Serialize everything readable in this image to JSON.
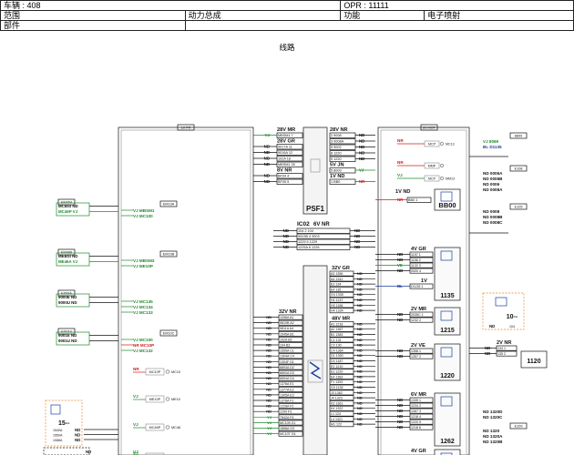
{
  "header": {
    "vehicle_label": "车辆 : 408",
    "opr_label": "OPR : 11111",
    "scope_label": "范围",
    "scope_value": "动力总成",
    "function_label": "功能",
    "function_value": "电子喷射",
    "part_label": "部件"
  },
  "diagram_title": "线路",
  "colors": {
    "blue": "#1a3fa0",
    "green": "#1f8a2c",
    "red": "#d01b1b",
    "orange": "#e8892a",
    "grey": "#9a9a9a",
    "line": "#111111"
  },
  "frames": {
    "left_tag": "10 PR",
    "right_tag": "20 MOT"
  },
  "psf1": {
    "label": "PSF1",
    "left_rows": [
      {
        "title": "28V MR",
        "sig": "VJ",
        "text": "MBSM1 7"
      },
      {
        "title": "28V GR",
        "sig": "ND",
        "text": "9017A 11"
      },
      {
        "sig": "ND",
        "text": "9016A 12"
      },
      {
        "sig": "ND",
        "text": "102A 16"
      },
      {
        "sig": "ND",
        "text": "MBSM1 26"
      },
      {
        "title": "8V NR",
        "sig": "ND",
        "text": "BF04 4"
      },
      {
        "sig": "ND",
        "text": "BF05 5"
      }
    ],
    "right_rows": [
      {
        "title": "28V NR",
        "sig": "ND",
        "text": "2 9008"
      },
      {
        "sig": "ND",
        "text": "3 9008A"
      },
      {
        "sig": "ND",
        "text": "5 9002"
      },
      {
        "sig": "ND",
        "text": "8 1220"
      },
      {
        "sig": "ND",
        "text": "9 1220"
      },
      {
        "title": "5V JN",
        "sig": "VJ",
        "text": "5 8009"
      },
      {
        "title": "1V ND",
        "sig": "NR",
        "text": "1 BB0"
      }
    ]
  },
  "ic02": {
    "label": "IC02",
    "label2": "6V NR",
    "rows": [
      {
        "l": "ND",
        "text": "104 2 104",
        "r": "ND"
      },
      {
        "l": "ND",
        "text": "9003B 4 9003",
        "r": "ND"
      },
      {
        "l": "ND",
        "text": "1229 5 1229",
        "r": "ND"
      },
      {
        "l": "ND",
        "text": "1225A 6 1226",
        "r": "ND"
      }
    ]
  },
  "fuse_block": {
    "groups": [
      {
        "title": "32V GR",
        "rows": [
          "A3 1356",
          "A4 1341",
          "E3 134",
          "E4 135",
          "G4 1335",
          "H1 1137",
          "H3 1156",
          "H4 1334"
        ]
      },
      {
        "title": "48V MR",
        "rows": [
          "A1 1218",
          "A2 1387",
          "B1 1383",
          "C1 131",
          "C2 130",
          "C4 1364",
          "D1 1300",
          "D3 1187",
          "E2 1210",
          "E3 1220",
          "E4 1383",
          "F1 1393",
          "G3 1135",
          "J3 1362",
          "J4 1323",
          "K3 1361",
          "K4 1322",
          "L1 124",
          "L4 1321",
          "M1 122"
        ]
      }
    ],
    "left_title": "32V NR",
    "left_rows": [
      "1056A A1",
      "9810B A2",
      "9811A A4",
      "1545A B1",
      "102A B2",
      "104 B3",
      "1555A C1",
      "1304A C4",
      "1304F D1",
      "6893A D2",
      "6892A D3",
      "6894A D4",
      "1378A E1",
      "1377A E2",
      "1305A E3",
      "1378A F1",
      "1228A F2",
      "1299 F3",
      "7842A F4",
      "MC105 G1",
      "1858A G3",
      "MC10T G4"
    ],
    "left_sig": [
      "ND",
      "ND",
      "ND",
      "ND",
      "ND",
      "ND",
      "ND",
      "ND",
      "ND",
      "ND",
      "ND",
      "ND",
      "ND",
      "ND",
      "ND",
      "ND",
      "ND",
      "ND",
      "VJ",
      "VJ",
      "VJ",
      "VJ"
    ]
  },
  "bb00": {
    "label": "BB00",
    "row_title": "1V ND",
    "row_text": "BB0 1",
    "sig": "NR"
  },
  "left_components": [
    {
      "code": "EM454",
      "sigs": [
        "MCBSI ND",
        "MC46P VJ"
      ],
      "conn": "EM10A",
      "wires": [
        "VJ MBSM1",
        "VJ MC100"
      ]
    },
    {
      "code": "EM488",
      "sigs": [
        "MEBSI ND",
        "ME46A VJ"
      ],
      "conn": "EM10B",
      "wires": [
        "VJ MBSM3",
        "VJ ME10P"
      ]
    },
    {
      "code": "EX09A",
      "sigs": [
        "9000E ND",
        "9000U ND"
      ],
      "wires": [
        "VJ MC135",
        "VJ MC134",
        "VJ MC133"
      ]
    },
    {
      "code": "EX014",
      "sigs": [
        "9001E ND",
        "9001U ND"
      ],
      "conn": "EM10C",
      "wires": [
        "VJ MC100",
        "NR MC10P",
        "VJ MC132"
      ]
    }
  ],
  "bus_items": [
    {
      "sig": "NR",
      "label": "MC10P",
      "tag": "MC10"
    },
    {
      "sig": "VJ",
      "label": "ME10P",
      "tag": "ME10"
    },
    {
      "sig": "VJ",
      "label": "MC46P",
      "tag": "MC46"
    },
    {
      "sig": "VJ",
      "label": "ME10P",
      "tag": ""
    }
  ],
  "comp15": {
    "label": "15--",
    "rows": [
      "1540A",
      "1550A",
      "1088A"
    ],
    "sigs": [
      "ND",
      "ND",
      "ND"
    ]
  },
  "right_modules": [
    {
      "label": "BB00"
    },
    {
      "label": "1135",
      "title": "4V GR",
      "rows": [
        "1157 1",
        "1156 2",
        "1133 3",
        "0000 4"
      ],
      "sigs": [
        "ND",
        "ND",
        "VE",
        "ND"
      ],
      "title2": "1V",
      "row2": "D1135 1",
      "sig2": "BL"
    },
    {
      "label": "1215",
      "title": "2V MR",
      "rows": [
        "2035C 1",
        "1232 2"
      ],
      "sigs": [
        "ND",
        "ND"
      ]
    },
    {
      "label": "1220",
      "title": "2V VE",
      "rows": [
        "1358 1",
        "1357 2"
      ],
      "sigs": [
        "ND",
        "ND"
      ]
    },
    {
      "label": "1262",
      "title": "6V MR",
      "rows": [
        "1335 1",
        "1234 2",
        "1367 3",
        "1218 4",
        "1220 5",
        "1218 6"
      ],
      "sigs": [
        "ND",
        "ND",
        "ND",
        "ND",
        "ND",
        "ND"
      ]
    },
    {
      "label": "",
      "title": "4V GR"
    }
  ],
  "mcp": [
    {
      "sig": "NR",
      "label": "MCP",
      "tag": "MC13"
    },
    {
      "sig": "NR",
      "label": "MMP",
      "tag": ""
    },
    {
      "sig": "VJ",
      "label": "MCP",
      "tag": "MM13"
    }
  ],
  "far_right": {
    "top_tag": "8809",
    "top_lines": [
      "VJ 8069",
      "BL D1135"
    ],
    "tag2": "E108",
    "lines2": [
      "ND 0006A",
      "ND 0006B",
      "ND 0006",
      "ND 0008A"
    ],
    "tag3": "E105",
    "lines3": [
      "ND 0008",
      "ND 0008B",
      "ND 0008C"
    ],
    "comp10": {
      "label": "10--",
      "sig": "ND",
      "code": "104"
    },
    "comp1120": {
      "label": "1120",
      "title": "2V NR",
      "rows": [
        "134 1",
        "135 2"
      ],
      "sigs": [
        "ND",
        "ND"
      ]
    },
    "lines4": [
      "ND 1320D",
      "ND 1320C"
    ],
    "tag5": "E109",
    "lines5": [
      "ND 1320",
      "ND 1320A",
      "ND 1320B"
    ]
  },
  "bottom_left": {
    "sig": "ND",
    "sig2": "VJ"
  }
}
